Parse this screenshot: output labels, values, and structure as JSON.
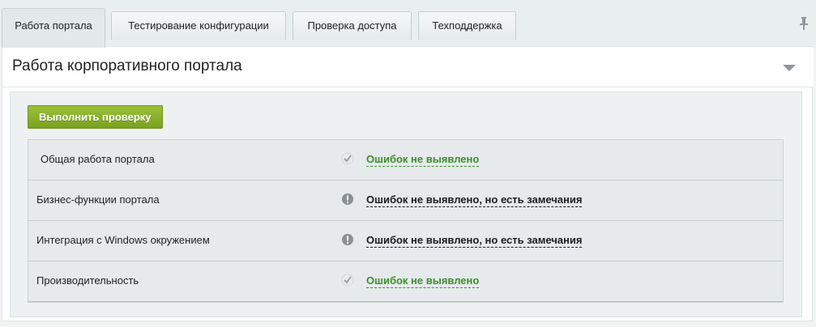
{
  "tabs": [
    {
      "label": "Работа портала",
      "active": true
    },
    {
      "label": "Тестирование конфигурации",
      "active": false
    },
    {
      "label": "Проверка доступа",
      "active": false
    },
    {
      "label": "Техподдержка",
      "active": false
    }
  ],
  "toolbar": {
    "pin_icon": "pin-icon"
  },
  "section": {
    "title": "Работа корпоративного портала",
    "collapse_icon": "chevron-down-icon",
    "run_button_label": "Выполнить проверку",
    "run_button_color": "#8ab22d"
  },
  "results": [
    {
      "label": "Общая работа портала",
      "status": "Ошибок не выявлено",
      "type": "ok",
      "icon": "check-icon"
    },
    {
      "label": "Бизнес-функции портала",
      "status": "Ошибок не выявлено, но есть замечания",
      "type": "warn",
      "icon": "warning-icon"
    },
    {
      "label": "Интеграция с Windows окружением",
      "status": "Ошибок не выявлено, но есть замечания",
      "type": "warn",
      "icon": "warning-icon"
    },
    {
      "label": "Производительность",
      "status": "Ошибок не выявлено",
      "type": "ok",
      "icon": "check-icon"
    }
  ],
  "colors": {
    "ok": "#3b8f2a",
    "warn": "#1b1b1b"
  }
}
